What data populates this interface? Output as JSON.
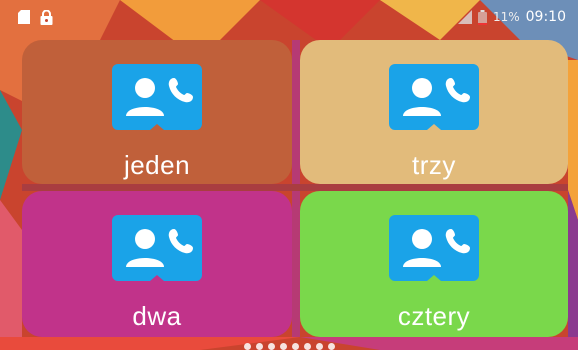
{
  "status_bar": {
    "battery_percent": "11%",
    "time": "09:10",
    "icons": [
      "sd-card-icon",
      "lock-icon",
      "signal-icon",
      "battery-icon"
    ]
  },
  "tiles": [
    {
      "label": "jeden",
      "color": "#c0603a",
      "icon": "contact-phone-icon"
    },
    {
      "label": "trzy",
      "color": "#e2bb7b",
      "icon": "contact-phone-icon"
    },
    {
      "label": "dwa",
      "color": "#c1338a",
      "icon": "contact-phone-icon"
    },
    {
      "label": "cztery",
      "color": "#7ad84b",
      "icon": "contact-phone-icon"
    }
  ],
  "icon_color": "#1aa3e8",
  "page_indicator": {
    "count": 8
  }
}
